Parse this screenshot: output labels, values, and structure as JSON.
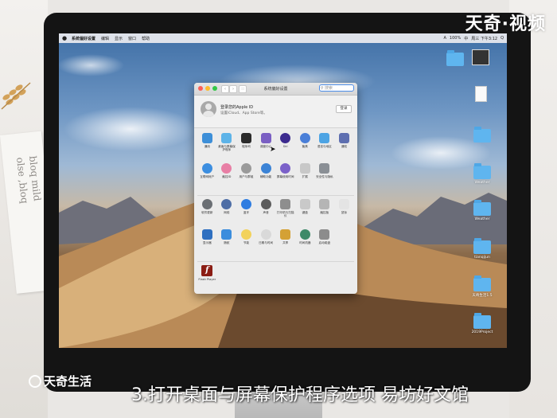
{
  "overlay": {
    "brand_watermark": "天奇·视频",
    "logo_text": "天奇生活",
    "caption": "3.打开桌面与屏幕保护程序选项   易坊好文馆"
  },
  "paper_text": "bloq mild\nolse ,bloq",
  "menubar": {
    "app_name": "系统偏好设置",
    "menus": [
      "编辑",
      "显示",
      "窗口",
      "帮助"
    ],
    "status": [
      "A",
      "100%",
      "中",
      "周三 下午3:12",
      "Q"
    ]
  },
  "desktop": {
    "icons": [
      {
        "name": "folder-top-left",
        "label": ""
      },
      {
        "name": "screenshot-thumb",
        "label": ""
      },
      {
        "name": "text-file",
        "label": ""
      },
      {
        "name": "folder-2",
        "label": ""
      },
      {
        "name": "folder-weather",
        "label": "Weather"
      },
      {
        "name": "folder-weather2",
        "label": "Weather"
      },
      {
        "name": "folder-tianqi",
        "label": "tianqijun"
      },
      {
        "name": "folder-version",
        "label": "天奇生活1.5"
      },
      {
        "name": "folder-project",
        "label": "2019Project"
      }
    ]
  },
  "window": {
    "title": "系统偏好设置",
    "search_placeholder": "搜索",
    "account": {
      "title": "登录您的Apple ID",
      "subtitle": "设置iCloud、App Store等。",
      "button": "登录"
    },
    "rows": [
      [
        {
          "label": "通用",
          "color": "#3d8fd8"
        },
        {
          "label": "桌面与屏幕保护程序",
          "color": "#5db3e8"
        },
        {
          "label": "程序坞",
          "color": "#2b2b2b"
        },
        {
          "label": "调度中心",
          "color": "#7a5fc3"
        },
        {
          "label": "Siri",
          "color": "#3c2b8f",
          "round": true
        },
        {
          "label": "聚焦",
          "color": "#4a7fd8",
          "round": true
        },
        {
          "label": "语言与地区",
          "color": "#4da4e4"
        },
        {
          "label": "通知",
          "color": "#5e6fb0"
        }
      ],
      [
        {
          "label": "互联网帐户",
          "color": "#3c8ee0",
          "round": true
        },
        {
          "label": "触控ID",
          "color": "#e87fa5",
          "round": true
        },
        {
          "label": "用户与群组",
          "color": "#9a9a9a",
          "round": true
        },
        {
          "label": "辅助功能",
          "color": "#3b83d6",
          "round": true
        },
        {
          "label": "屏幕使用时间",
          "color": "#7b61c9",
          "round": true
        },
        {
          "label": "扩展",
          "color": "#c8c8c8"
        },
        {
          "label": "安全性与隐私",
          "color": "#8a8f95"
        }
      ],
      [
        {
          "label": "软件更新",
          "color": "#6b6f74",
          "round": true
        },
        {
          "label": "网络",
          "color": "#4e6ea6",
          "round": true
        },
        {
          "label": "蓝牙",
          "color": "#2f7de1",
          "round": true
        },
        {
          "label": "声音",
          "color": "#5c5c5c",
          "round": true
        },
        {
          "label": "打印机与扫描仪",
          "color": "#8e8e8e"
        },
        {
          "label": "键盘",
          "color": "#c9c9c9"
        },
        {
          "label": "触控板",
          "color": "#b5b5b5"
        },
        {
          "label": "鼠标",
          "color": "#e4e4e4"
        }
      ],
      [
        {
          "label": "显示器",
          "color": "#2e6fc0"
        },
        {
          "label": "随航",
          "color": "#3b8ddd"
        },
        {
          "label": "节能",
          "color": "#f2d25b",
          "round": true
        },
        {
          "label": "日期与时间",
          "color": "#d9d9d9",
          "round": true
        },
        {
          "label": "共享",
          "color": "#d4a135"
        },
        {
          "label": "时间机器",
          "color": "#3e8a68",
          "round": true
        },
        {
          "label": "启动磁盘",
          "color": "#8c8c8c"
        }
      ]
    ],
    "other": [
      {
        "label": "Flash Player",
        "glyph": "f"
      }
    ]
  },
  "colors": {
    "accent": "#4d8ee8",
    "close": "#fc5f57",
    "minimize": "#fdbc2e",
    "zoom": "#33c748"
  }
}
